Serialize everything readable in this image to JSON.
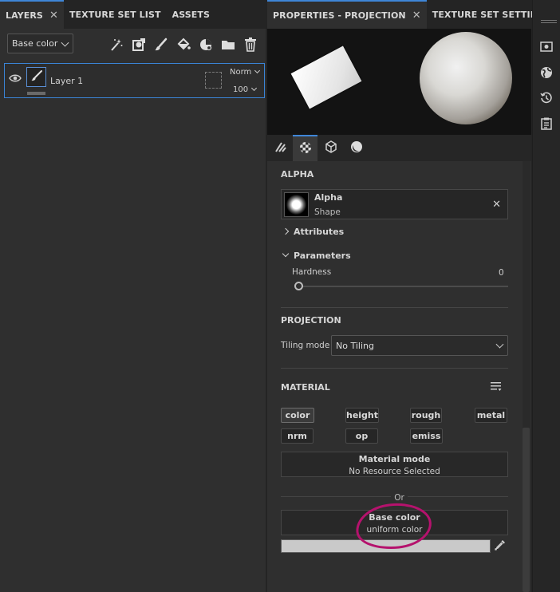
{
  "left_panel": {
    "tabs": [
      {
        "label": "LAYERS",
        "active": true,
        "closable": true
      },
      {
        "label": "TEXTURE SET LIST",
        "active": false
      },
      {
        "label": "ASSETS",
        "active": false
      }
    ],
    "channel_select": "Base color",
    "toolbar_icons": [
      "magic-wand-icon",
      "add-effect-icon",
      "paint-layer-icon",
      "fill-layer-icon",
      "smart-material-icon",
      "folder-icon",
      "trash-icon"
    ],
    "layer": {
      "name": "Layer 1",
      "blend_mode": "Norm",
      "opacity": "100"
    }
  },
  "right_panel": {
    "tabs": [
      {
        "label": "PROPERTIES - PROJECTION",
        "active": true,
        "closable": true
      },
      {
        "label": "TEXTURE SET SETTINGS",
        "active": false
      }
    ],
    "prop_tab_icons": [
      "brush-stroke-icon",
      "alpha-checker-icon",
      "cube-icon",
      "material-sphere-icon"
    ],
    "alpha": {
      "section": "ALPHA",
      "name": "Alpha",
      "subtitle": "Shape",
      "attributes_label": "Attributes",
      "parameters_label": "Parameters",
      "hardness_label": "Hardness",
      "hardness_value": "0"
    },
    "projection": {
      "section": "PROJECTION",
      "tiling_label": "Tiling mode",
      "tiling_value": "No Tiling"
    },
    "material": {
      "section": "MATERIAL",
      "channels": [
        {
          "label": "color",
          "on": true
        },
        {
          "label": "height",
          "on": false
        },
        {
          "label": "rough",
          "on": false
        },
        {
          "label": "metal",
          "on": false
        },
        {
          "label": "nrm",
          "on": false
        },
        {
          "label": "op",
          "on": false
        },
        {
          "label": "emiss",
          "on": false
        }
      ],
      "material_mode_title": "Material mode",
      "material_mode_value": "No Resource Selected",
      "or_label": "Or",
      "base_color_title": "Base color",
      "base_color_value": "uniform color",
      "base_color_swatch": "#c9c9c9"
    }
  },
  "dock_icons": [
    "display-settings-icon",
    "environment-icon",
    "history-icon",
    "log-icon"
  ],
  "colors": {
    "accent": "#3f86d8",
    "annotation": "#b5126d"
  }
}
